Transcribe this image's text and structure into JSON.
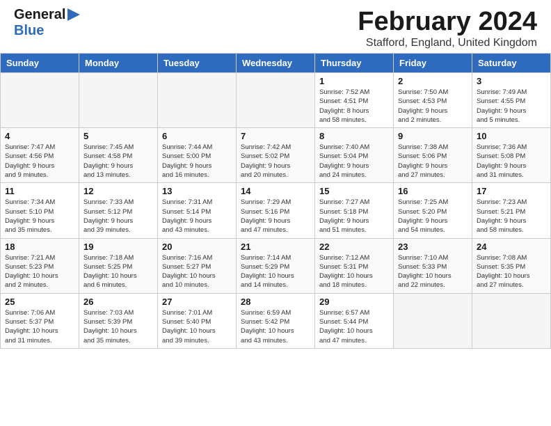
{
  "header": {
    "logo_general": "General",
    "logo_blue": "Blue",
    "month_title": "February 2024",
    "location": "Stafford, England, United Kingdom"
  },
  "weekdays": [
    "Sunday",
    "Monday",
    "Tuesday",
    "Wednesday",
    "Thursday",
    "Friday",
    "Saturday"
  ],
  "weeks": [
    [
      {
        "day": "",
        "info": ""
      },
      {
        "day": "",
        "info": ""
      },
      {
        "day": "",
        "info": ""
      },
      {
        "day": "",
        "info": ""
      },
      {
        "day": "1",
        "info": "Sunrise: 7:52 AM\nSunset: 4:51 PM\nDaylight: 8 hours\nand 58 minutes."
      },
      {
        "day": "2",
        "info": "Sunrise: 7:50 AM\nSunset: 4:53 PM\nDaylight: 9 hours\nand 2 minutes."
      },
      {
        "day": "3",
        "info": "Sunrise: 7:49 AM\nSunset: 4:55 PM\nDaylight: 9 hours\nand 5 minutes."
      }
    ],
    [
      {
        "day": "4",
        "info": "Sunrise: 7:47 AM\nSunset: 4:56 PM\nDaylight: 9 hours\nand 9 minutes."
      },
      {
        "day": "5",
        "info": "Sunrise: 7:45 AM\nSunset: 4:58 PM\nDaylight: 9 hours\nand 13 minutes."
      },
      {
        "day": "6",
        "info": "Sunrise: 7:44 AM\nSunset: 5:00 PM\nDaylight: 9 hours\nand 16 minutes."
      },
      {
        "day": "7",
        "info": "Sunrise: 7:42 AM\nSunset: 5:02 PM\nDaylight: 9 hours\nand 20 minutes."
      },
      {
        "day": "8",
        "info": "Sunrise: 7:40 AM\nSunset: 5:04 PM\nDaylight: 9 hours\nand 24 minutes."
      },
      {
        "day": "9",
        "info": "Sunrise: 7:38 AM\nSunset: 5:06 PM\nDaylight: 9 hours\nand 27 minutes."
      },
      {
        "day": "10",
        "info": "Sunrise: 7:36 AM\nSunset: 5:08 PM\nDaylight: 9 hours\nand 31 minutes."
      }
    ],
    [
      {
        "day": "11",
        "info": "Sunrise: 7:34 AM\nSunset: 5:10 PM\nDaylight: 9 hours\nand 35 minutes."
      },
      {
        "day": "12",
        "info": "Sunrise: 7:33 AM\nSunset: 5:12 PM\nDaylight: 9 hours\nand 39 minutes."
      },
      {
        "day": "13",
        "info": "Sunrise: 7:31 AM\nSunset: 5:14 PM\nDaylight: 9 hours\nand 43 minutes."
      },
      {
        "day": "14",
        "info": "Sunrise: 7:29 AM\nSunset: 5:16 PM\nDaylight: 9 hours\nand 47 minutes."
      },
      {
        "day": "15",
        "info": "Sunrise: 7:27 AM\nSunset: 5:18 PM\nDaylight: 9 hours\nand 51 minutes."
      },
      {
        "day": "16",
        "info": "Sunrise: 7:25 AM\nSunset: 5:20 PM\nDaylight: 9 hours\nand 54 minutes."
      },
      {
        "day": "17",
        "info": "Sunrise: 7:23 AM\nSunset: 5:21 PM\nDaylight: 9 hours\nand 58 minutes."
      }
    ],
    [
      {
        "day": "18",
        "info": "Sunrise: 7:21 AM\nSunset: 5:23 PM\nDaylight: 10 hours\nand 2 minutes."
      },
      {
        "day": "19",
        "info": "Sunrise: 7:18 AM\nSunset: 5:25 PM\nDaylight: 10 hours\nand 6 minutes."
      },
      {
        "day": "20",
        "info": "Sunrise: 7:16 AM\nSunset: 5:27 PM\nDaylight: 10 hours\nand 10 minutes."
      },
      {
        "day": "21",
        "info": "Sunrise: 7:14 AM\nSunset: 5:29 PM\nDaylight: 10 hours\nand 14 minutes."
      },
      {
        "day": "22",
        "info": "Sunrise: 7:12 AM\nSunset: 5:31 PM\nDaylight: 10 hours\nand 18 minutes."
      },
      {
        "day": "23",
        "info": "Sunrise: 7:10 AM\nSunset: 5:33 PM\nDaylight: 10 hours\nand 22 minutes."
      },
      {
        "day": "24",
        "info": "Sunrise: 7:08 AM\nSunset: 5:35 PM\nDaylight: 10 hours\nand 27 minutes."
      }
    ],
    [
      {
        "day": "25",
        "info": "Sunrise: 7:06 AM\nSunset: 5:37 PM\nDaylight: 10 hours\nand 31 minutes."
      },
      {
        "day": "26",
        "info": "Sunrise: 7:03 AM\nSunset: 5:39 PM\nDaylight: 10 hours\nand 35 minutes."
      },
      {
        "day": "27",
        "info": "Sunrise: 7:01 AM\nSunset: 5:40 PM\nDaylight: 10 hours\nand 39 minutes."
      },
      {
        "day": "28",
        "info": "Sunrise: 6:59 AM\nSunset: 5:42 PM\nDaylight: 10 hours\nand 43 minutes."
      },
      {
        "day": "29",
        "info": "Sunrise: 6:57 AM\nSunset: 5:44 PM\nDaylight: 10 hours\nand 47 minutes."
      },
      {
        "day": "",
        "info": ""
      },
      {
        "day": "",
        "info": ""
      }
    ]
  ]
}
